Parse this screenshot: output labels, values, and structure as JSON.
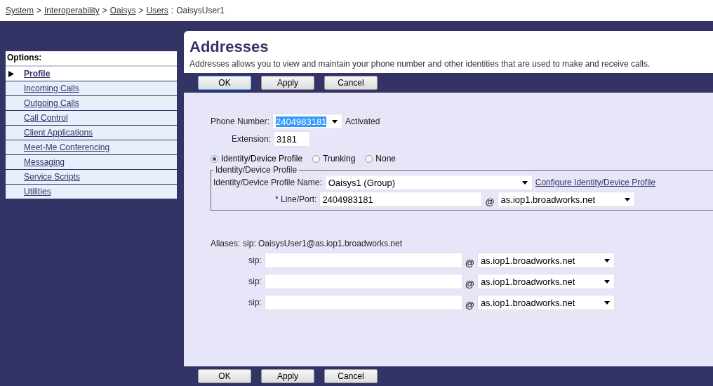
{
  "breadcrumb": [
    {
      "kind": "link",
      "label": "System"
    },
    {
      "kind": "separator",
      "label": ">"
    },
    {
      "kind": "link",
      "label": "Interoperability"
    },
    {
      "kind": "separator",
      "label": ">"
    },
    {
      "kind": "link",
      "label": "Oaisys"
    },
    {
      "kind": "separator",
      "label": ">"
    },
    {
      "kind": "link",
      "label": "Users"
    },
    {
      "kind": "separator",
      "label": ":"
    },
    {
      "kind": "current",
      "label": "OaisysUser1"
    }
  ],
  "sidebar": {
    "title": "Options:",
    "items": [
      {
        "label": "Profile",
        "selected": true
      },
      {
        "label": "Incoming Calls",
        "selected": false
      },
      {
        "label": "Outgoing Calls",
        "selected": false
      },
      {
        "label": "Call Control",
        "selected": false
      },
      {
        "label": "Client Applications",
        "selected": false
      },
      {
        "label": "Meet-Me Conferencing",
        "selected": false
      },
      {
        "label": "Messaging",
        "selected": false
      },
      {
        "label": "Service Scripts",
        "selected": false
      },
      {
        "label": "Utilities",
        "selected": false
      }
    ]
  },
  "page": {
    "title": "Addresses",
    "description": "Addresses allows you to view and maintain your phone number and other identities that are used to make and receive calls."
  },
  "top_buttons": [
    {
      "label": "OK",
      "focused": true
    },
    {
      "label": "Apply",
      "focused": false
    },
    {
      "label": "Cancel",
      "focused": false
    }
  ],
  "phone_number": {
    "label": "Phone Number:",
    "value": "2404983181",
    "status": "Activated"
  },
  "extension": {
    "label": "Extension:",
    "value": "3181"
  },
  "profile_type": [
    {
      "label": "Identity/Device Profile",
      "selected": true
    },
    {
      "label": "Trunking",
      "selected": false
    },
    {
      "label": "None",
      "selected": false
    }
  ],
  "identity_profile": {
    "legend": "Identity/Device Profile",
    "name_label": "Identity/Device Profile Name:",
    "name_value": "Oaisys1 (Group)",
    "configure_link": "Configure Identity/Device Profile",
    "line_port_label": "* Line/Port:",
    "line_port_value": "2404983181",
    "at": "@",
    "domain": "as.iop1.broadworks.net"
  },
  "aliases": {
    "label": "Aliases:",
    "primary": "sip: OaisysUser1@as.iop1.broadworks.net",
    "rows": [
      {
        "label": "sip:",
        "value": "",
        "at": "@",
        "domain": "as.iop1.broadworks.net"
      },
      {
        "label": "sip:",
        "value": "",
        "at": "@",
        "domain": "as.iop1.broadworks.net"
      },
      {
        "label": "sip:",
        "value": "",
        "at": "@",
        "domain": "as.iop1.broadworks.net"
      }
    ]
  },
  "bottom_buttons": [
    {
      "label": "OK",
      "focused": false
    },
    {
      "label": "Apply",
      "focused": false
    },
    {
      "label": "Cancel",
      "focused": false
    }
  ]
}
